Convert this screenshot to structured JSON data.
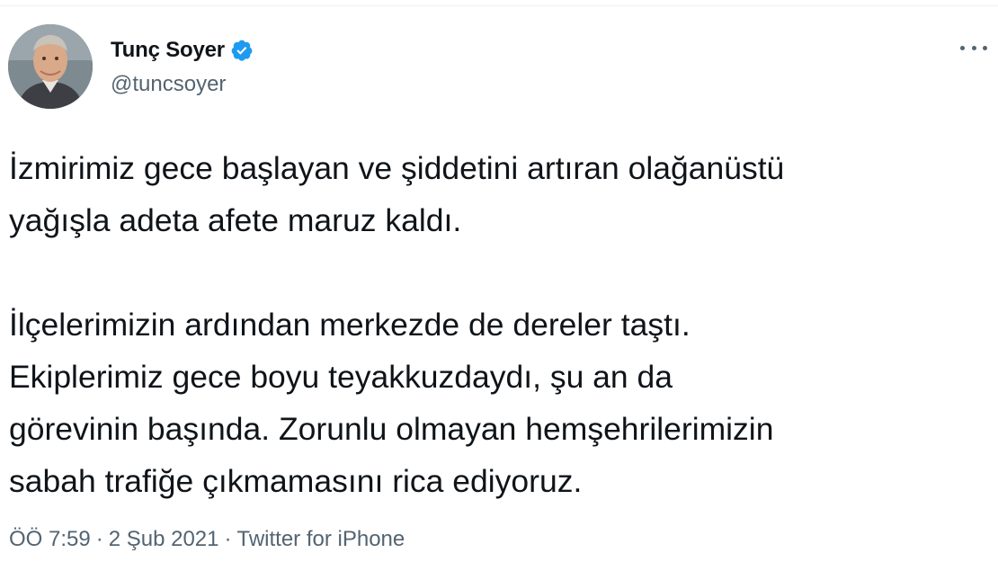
{
  "author": {
    "name": "Tunç Soyer",
    "handle": "@tuncsoyer",
    "verified": true
  },
  "tweet": {
    "paragraphs": [
      [
        "İzmirimiz gece başlayan ve şiddetini artıran olağanüstü",
        "yağışla adeta afete maruz kaldı."
      ],
      [
        "İlçelerimizin ardından merkezde de dereler taştı.",
        "Ekiplerimiz gece boyu teyakkuzdaydı, şu an da",
        "görevinin başında. Zorunlu olmayan hemşehrilerimizin",
        "sabah trafiğe çıkmamasını rica ediyoruz."
      ]
    ]
  },
  "meta": {
    "time": "ÖÖ 7:59",
    "date": "2 Şub 2021",
    "source": "Twitter for iPhone",
    "separator": "·"
  },
  "icons": {
    "verified": "verified-badge-icon",
    "more": "more-options-icon"
  },
  "colors": {
    "verified": "#1d9bf0",
    "text": "#0f1419",
    "secondary": "#536471"
  }
}
